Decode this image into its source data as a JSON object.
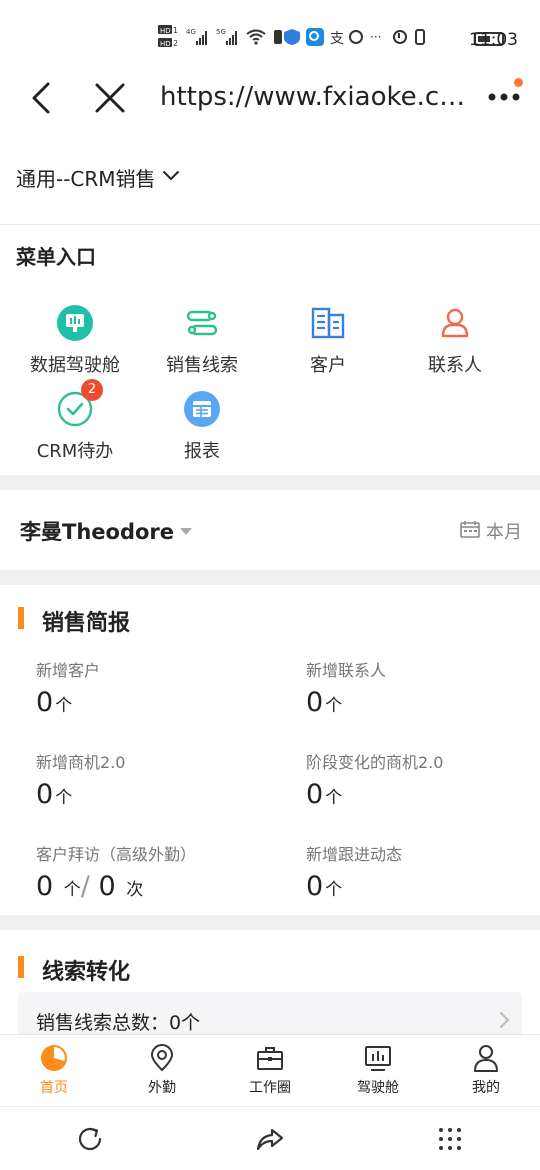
{
  "status_bar": {
    "time": "11:03",
    "icons": [
      "hd-icon",
      "signal-4g-icon",
      "signal-5g-icon",
      "wifi-icon",
      "battery-icon"
    ]
  },
  "nav": {
    "url": "https://www.fxiaoke.co..."
  },
  "scope": {
    "label": "通用--CRM销售"
  },
  "menu": {
    "title": "菜单入口",
    "items": [
      {
        "label": "数据驾驶舱",
        "icon": "dashboard-icon",
        "color": "#1fbfa8"
      },
      {
        "label": "销售线索",
        "icon": "leads-icon",
        "color": "#2fbf8f"
      },
      {
        "label": "客户",
        "icon": "building-icon",
        "color": "#3a7ee0"
      },
      {
        "label": "联系人",
        "icon": "person-icon",
        "color": "#ef6a4a"
      },
      {
        "label": "CRM待办",
        "icon": "todo-icon",
        "color": "#2fbf8f",
        "badge": "2"
      },
      {
        "label": "报表",
        "icon": "report-icon",
        "color": "#5aa6f5"
      }
    ]
  },
  "user": {
    "name": "李曼Theodore",
    "period": "本月"
  },
  "brief": {
    "title": "销售简报",
    "stats": [
      {
        "label": "新增客户",
        "value": "0",
        "unit": "个"
      },
      {
        "label": "新增联系人",
        "value": "0",
        "unit": "个"
      },
      {
        "label": "新增商机2.0",
        "value": "0",
        "unit": "个"
      },
      {
        "label": "阶段变化的商机2.0",
        "value": "0",
        "unit": "个"
      },
      {
        "label": "客户拜访（高级外勤）",
        "value": "0",
        "unit": "个",
        "sep": "/",
        "value2": "0",
        "unit2": "次"
      },
      {
        "label": "新增跟进动态",
        "value": "0",
        "unit": "个"
      }
    ]
  },
  "clue": {
    "title": "线索转化",
    "row_label": "销售线索总数：",
    "row_value": "0个"
  },
  "tabs": [
    {
      "label": "首页",
      "icon": "home-chart-icon",
      "active": true
    },
    {
      "label": "外勤",
      "icon": "location-icon"
    },
    {
      "label": "工作圈",
      "icon": "briefcase-icon"
    },
    {
      "label": "驾驶舱",
      "icon": "cockpit-icon"
    },
    {
      "label": "我的",
      "icon": "profile-icon"
    }
  ],
  "colors": {
    "accent": "#ff8b1a",
    "badge": "#f24a2e"
  }
}
